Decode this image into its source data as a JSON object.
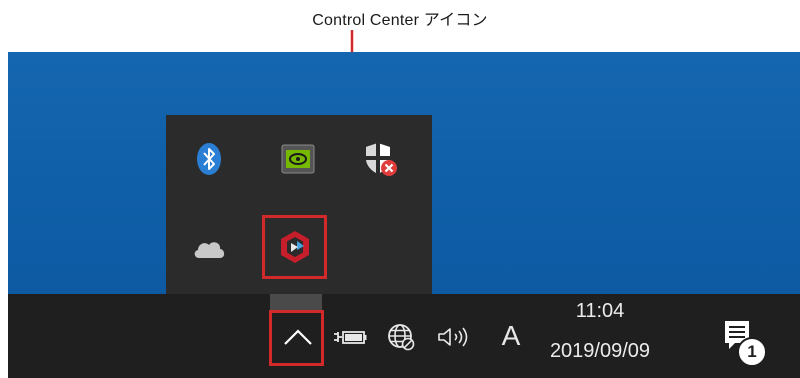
{
  "callout": {
    "label": "Control Center アイコン"
  },
  "taskbar": {
    "time": "11:04",
    "date": "2019/09/09",
    "ime_indicator": "A",
    "notification_count": "1"
  },
  "tray_flyout": {
    "icons": [
      "bluetooth-icon",
      "nvidia-icon",
      "windows-security-icon",
      "onedrive-icon",
      "control-center-icon"
    ]
  },
  "colors": {
    "desktop": "#1566b0",
    "taskbar": "#1f1f1f",
    "flyout": "#2b2b2b",
    "highlight": "#d22a2a"
  }
}
